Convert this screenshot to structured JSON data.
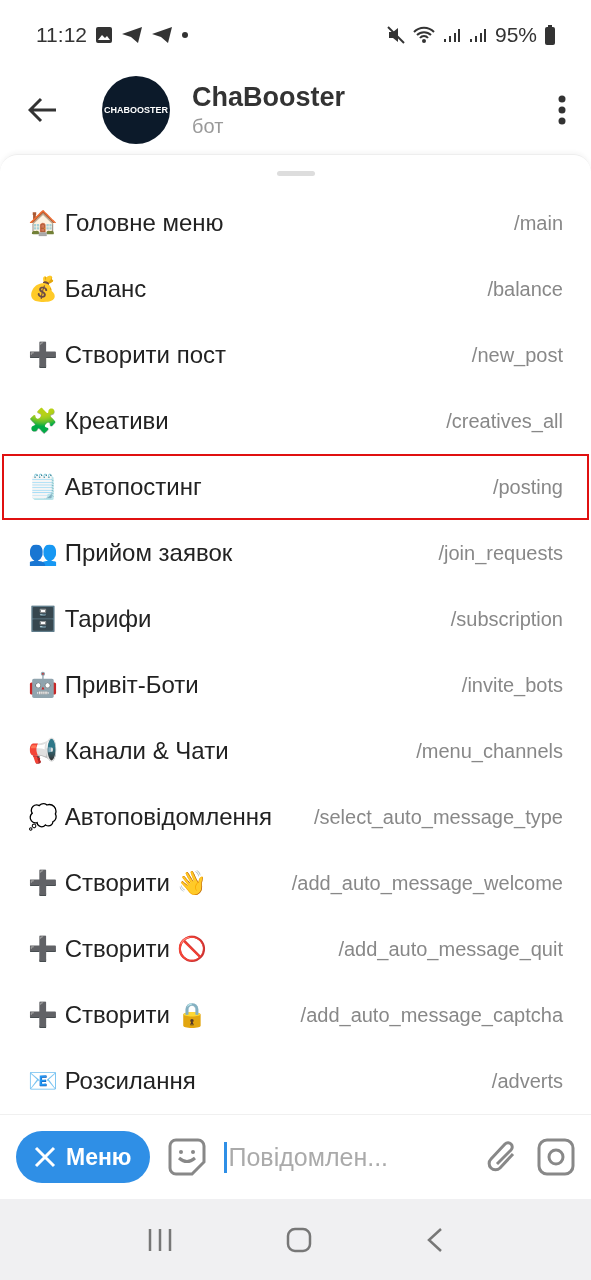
{
  "status_bar": {
    "time": "11:12",
    "battery": "95%"
  },
  "header": {
    "title": "ChaBooster",
    "subtitle": "бот",
    "avatar_text": "CHABOOSTER"
  },
  "commands": [
    {
      "label": "🏠 Головне меню",
      "command": "/main",
      "highlighted": false
    },
    {
      "label": "💰 Баланс",
      "command": "/balance",
      "highlighted": false
    },
    {
      "label": "➕ Створити пост",
      "command": "/new_post",
      "highlighted": false
    },
    {
      "label": "🧩 Креативи",
      "command": "/creatives_all",
      "highlighted": false
    },
    {
      "label": "🗒️ Автопостинг",
      "command": "/posting",
      "highlighted": true
    },
    {
      "label": "👥 Прийом заявок",
      "command": "/join_requests",
      "highlighted": false
    },
    {
      "label": "🗄️ Тарифи",
      "command": "/subscription",
      "highlighted": false
    },
    {
      "label": "🤖 Привіт-Боти",
      "command": "/invite_bots",
      "highlighted": false
    },
    {
      "label": "📢 Канали & Чати",
      "command": "/menu_channels",
      "highlighted": false
    },
    {
      "label": "💭 Автоповідомлення",
      "command": "/select_auto_message_type",
      "highlighted": false
    },
    {
      "label": "➕ Створити 👋",
      "command": "/add_auto_message_welcome",
      "highlighted": false
    },
    {
      "label": "➕ Створити 🚫",
      "command": "/add_auto_message_quit",
      "highlighted": false
    },
    {
      "label": "➕ Створити 🔒",
      "command": "/add_auto_message_captcha",
      "highlighted": false
    },
    {
      "label": "📧 Розсилання",
      "command": "/adverts",
      "highlighted": false
    }
  ],
  "composer": {
    "menu_button": "Меню",
    "placeholder": "Повідомлен..."
  }
}
